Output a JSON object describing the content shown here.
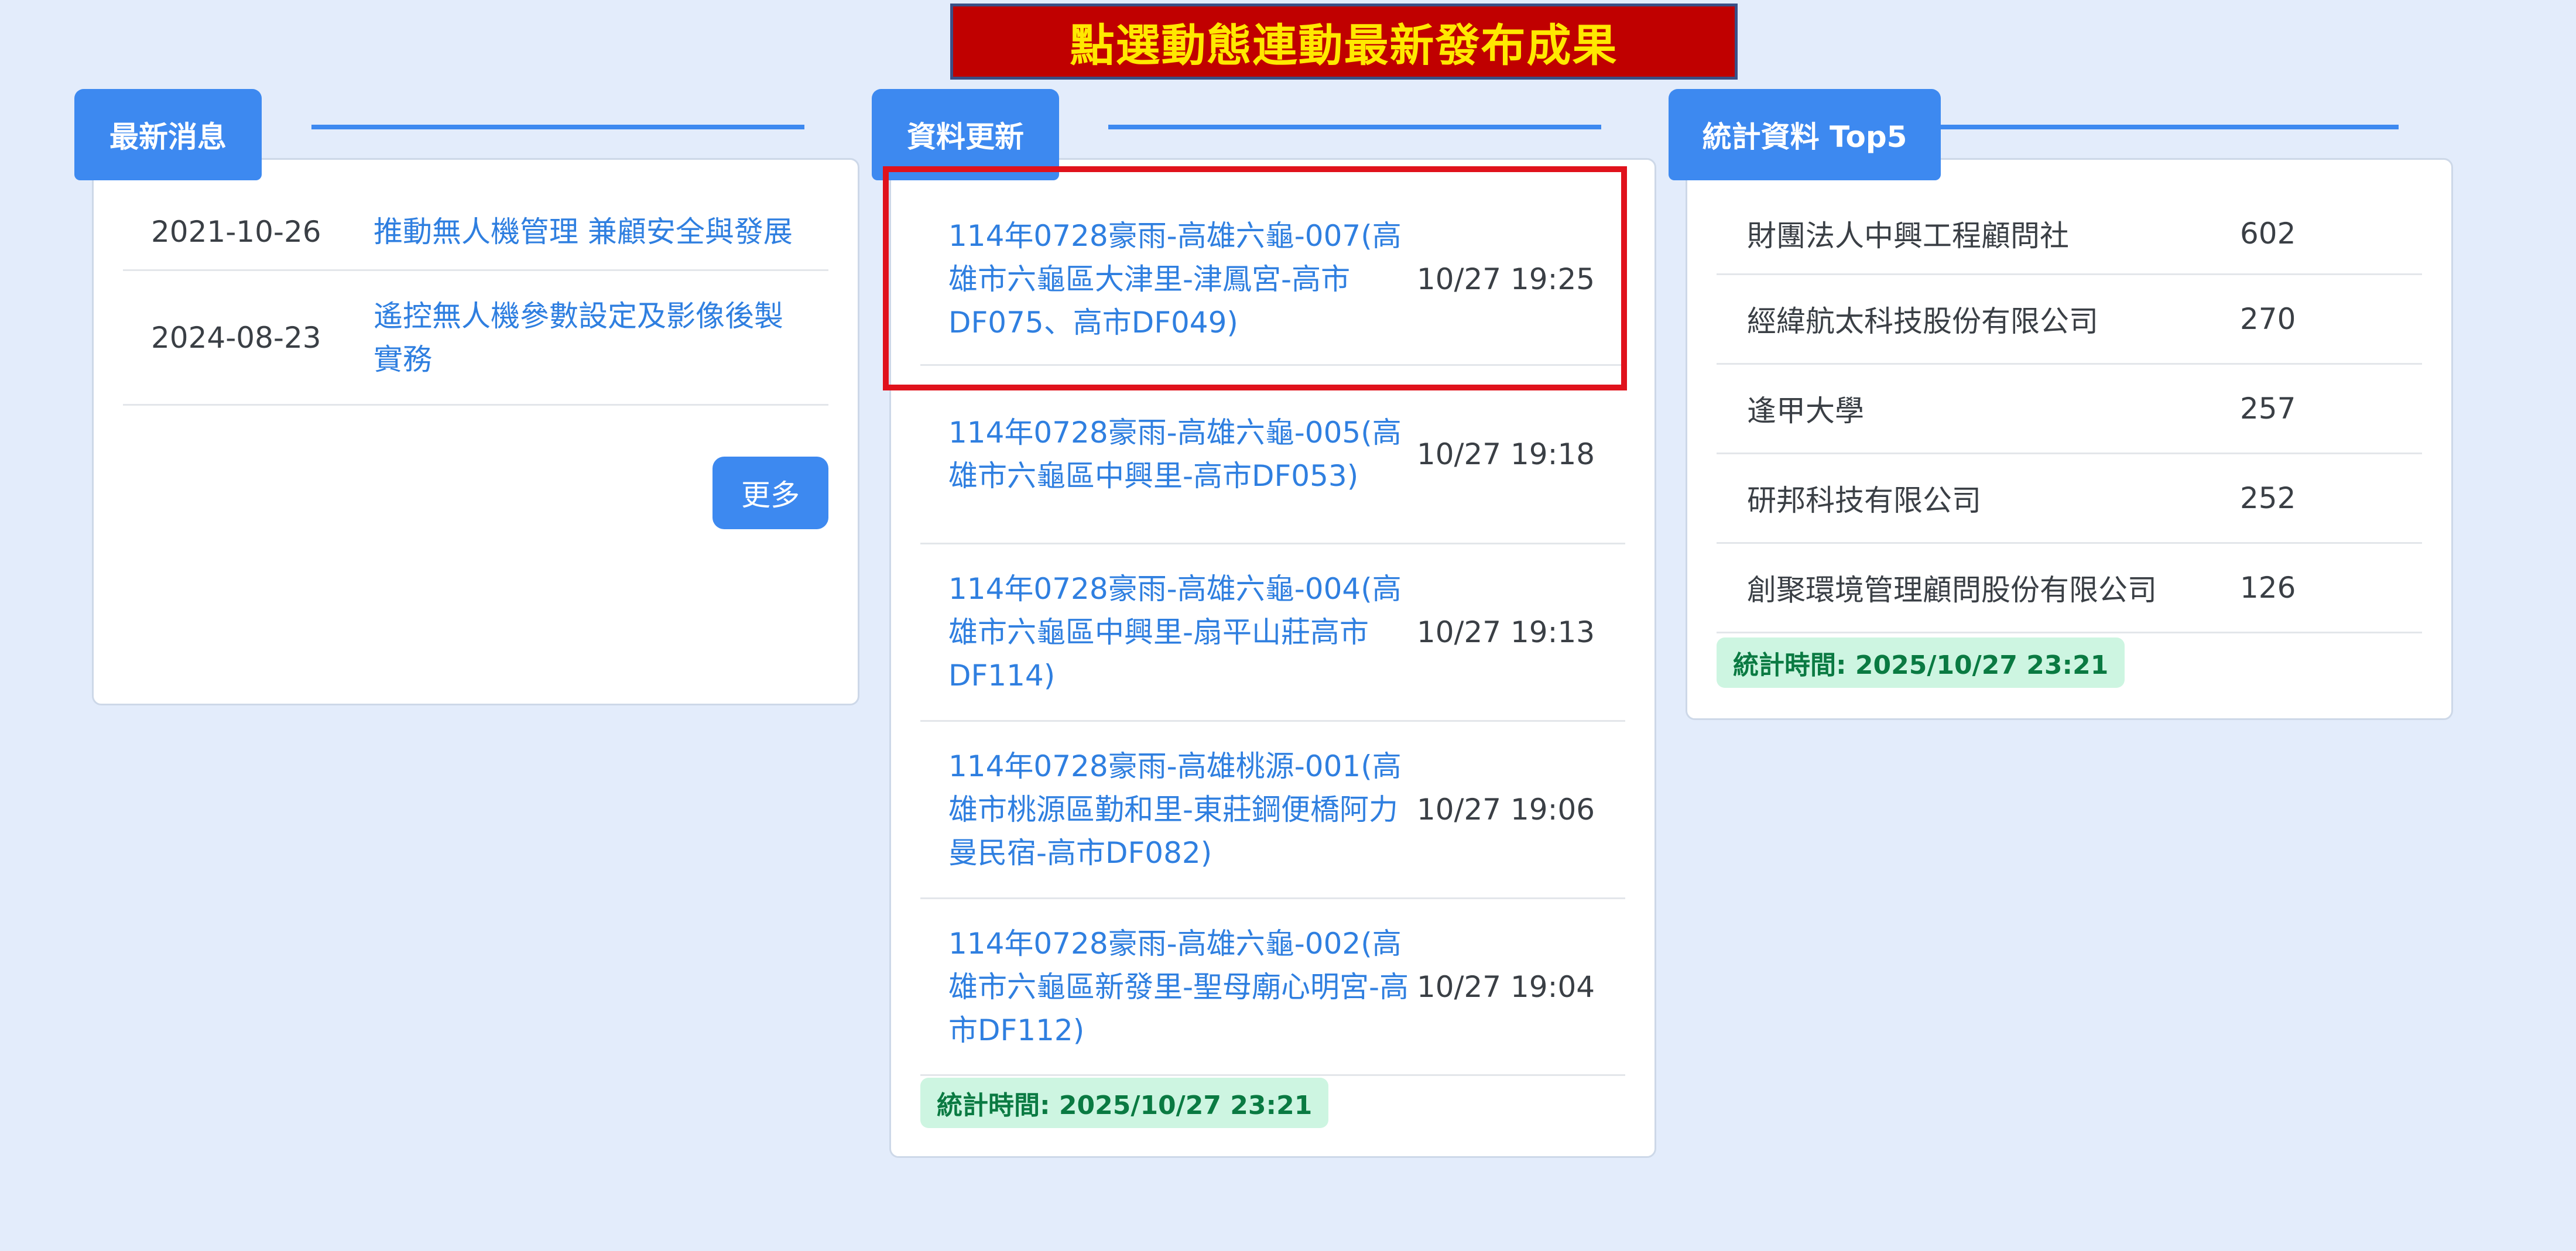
{
  "banner": {
    "text": "點選動態連動最新發布成果"
  },
  "news": {
    "tab": "最新消息",
    "items": [
      {
        "date": "2021-10-26",
        "title": "推動無人機管理 兼顧安全與發展"
      },
      {
        "date": "2024-08-23",
        "title": "遙控無人機參數設定及影像後製實務"
      }
    ],
    "more_label": "更多"
  },
  "updates": {
    "tab": "資料更新",
    "items": [
      {
        "title": "114年0728豪雨-高雄六龜-007(高雄市六龜區大津里-津鳳宮-高市DF075、高市DF049)",
        "time": "10/27 19:25"
      },
      {
        "title": "114年0728豪雨-高雄六龜-005(高雄市六龜區中興里-高市DF053)",
        "time": "10/27 19:18"
      },
      {
        "title": "114年0728豪雨-高雄六龜-004(高雄市六龜區中興里-扇平山莊高市DF114)",
        "time": "10/27 19:13"
      },
      {
        "title": "114年0728豪雨-高雄桃源-001(高雄市桃源區勤和里-東莊鋼便橋阿力曼民宿-高市DF082)",
        "time": "10/27 19:06"
      },
      {
        "title": "114年0728豪雨-高雄六龜-002(高雄市六龜區新發里-聖母廟心明宮-高市DF112)",
        "time": "10/27 19:04"
      }
    ],
    "stat_time": "統計時間: 2025/10/27 23:21"
  },
  "stats": {
    "tab": "統計資料 Top5",
    "items": [
      {
        "name": "財團法人中興工程顧問社",
        "value": "602"
      },
      {
        "name": "經緯航太科技股份有限公司",
        "value": "270"
      },
      {
        "name": "逢甲大學",
        "value": "257"
      },
      {
        "name": "研邦科技有限公司",
        "value": "252"
      },
      {
        "name": "創聚環境管理顧問股份有限公司",
        "value": "126"
      }
    ],
    "stat_time": "統計時間: 2025/10/27 23:21"
  },
  "colors": {
    "accent": "#3d89f0",
    "banner_bg": "#c00000",
    "banner_text": "#ffe800",
    "highlight": "#e0121c"
  }
}
